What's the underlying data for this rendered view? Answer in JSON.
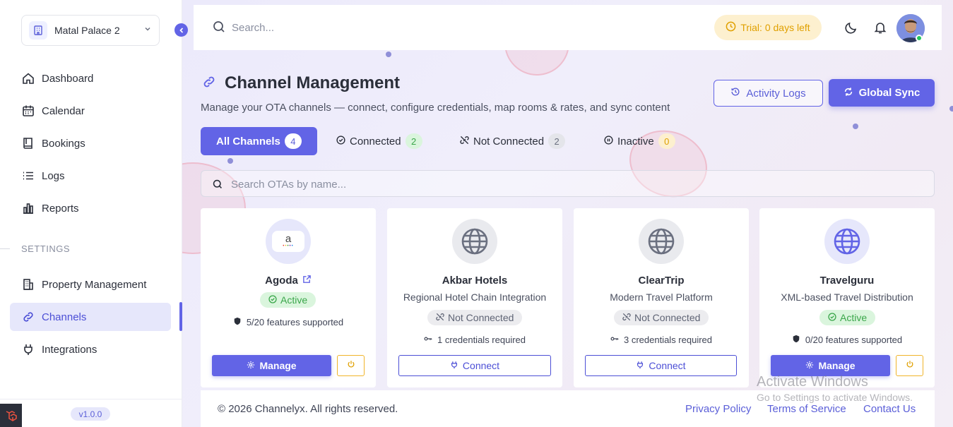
{
  "sidebar": {
    "property": "Matal Palace 2",
    "nav": [
      {
        "label": "Dashboard",
        "icon": "home-icon"
      },
      {
        "label": "Calendar",
        "icon": "calendar-icon"
      },
      {
        "label": "Bookings",
        "icon": "book-icon"
      },
      {
        "label": "Logs",
        "icon": "list-icon"
      },
      {
        "label": "Reports",
        "icon": "bar-chart-icon"
      }
    ],
    "settings_label": "SETTINGS",
    "settings_nav": [
      {
        "label": "Property Management",
        "icon": "building-icon"
      },
      {
        "label": "Channels",
        "icon": "link-icon",
        "active": true
      },
      {
        "label": "Integrations",
        "icon": "plug-icon"
      }
    ],
    "version": "v1.0.0"
  },
  "topbar": {
    "search_placeholder": "Search...",
    "trial": "Trial: 0 days left"
  },
  "page": {
    "title": "Channel Management",
    "subtitle": "Manage your OTA channels — connect, configure credentials, map rooms & rates, and sync content",
    "activity_logs": "Activity Logs",
    "global_sync": "Global Sync"
  },
  "tabs": [
    {
      "label": "All Channels",
      "count": "4",
      "active": true
    },
    {
      "label": "Connected",
      "count": "2"
    },
    {
      "label": "Not Connected",
      "count": "2"
    },
    {
      "label": "Inactive",
      "count": "0"
    }
  ],
  "ota_search_placeholder": "Search OTAs by name...",
  "channels": [
    {
      "name": "Agoda",
      "description": "",
      "status": "Active",
      "meta": "5/20 features supported",
      "action": "Manage"
    },
    {
      "name": "Akbar Hotels",
      "description": "Regional Hotel Chain Integration",
      "status": "Not Connected",
      "meta": "1 credentials required",
      "action": "Connect"
    },
    {
      "name": "ClearTrip",
      "description": "Modern Travel Platform",
      "status": "Not Connected",
      "meta": "3 credentials required",
      "action": "Connect"
    },
    {
      "name": "Travelguru",
      "description": "XML-based Travel Distribution",
      "status": "Active",
      "meta": "0/20 features supported",
      "action": "Manage"
    }
  ],
  "footer": {
    "copyright": "© 2026 Channelyx. All rights reserved.",
    "links": [
      "Privacy Policy",
      "Terms of Service",
      "Contact Us"
    ]
  },
  "watermark": {
    "line1": "Activate Windows",
    "line2": "Go to Settings to activate Windows."
  },
  "colors": {
    "accent": "#6264e6",
    "active_green": "#3aa64a",
    "trial_amber": "#e0a000"
  }
}
